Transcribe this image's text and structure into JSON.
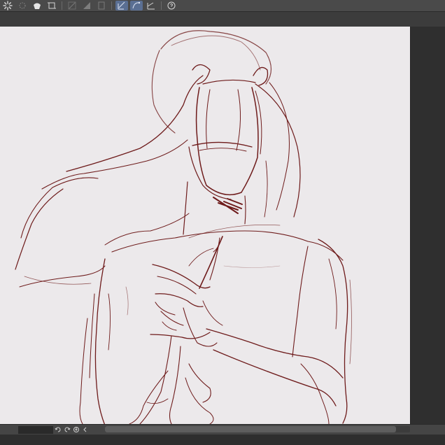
{
  "app": {
    "toolbar_icons": [
      "spinner-icon",
      "burst-select-icon",
      "fill-hand-icon",
      "crop-frame-icon",
      "ruler-off-icon",
      "gradient-icon",
      "frame-border-icon",
      "pen-stabilizer-icon",
      "curve-icon",
      "symmetry-icon",
      "help-icon"
    ],
    "active_tool_index": 7
  },
  "colors": {
    "ui_dark": "#3a3a3a",
    "toolbar": "#4a4a4a",
    "canvas_paper": "#ece9eb",
    "ink": "#6e1b1b",
    "active_highlight": "#5a6f93"
  },
  "statusbar": {
    "icons": [
      "rotate-left-icon",
      "rotate-right-icon",
      "reset-icon",
      "collapse-arrow-icon"
    ]
  }
}
